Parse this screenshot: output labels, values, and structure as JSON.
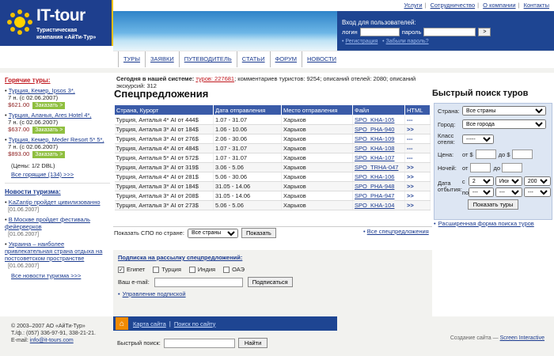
{
  "logo": {
    "brand": "IT-tour",
    "subtitle_line1": "Туристическая",
    "subtitle_line2": "компания «АйТи-Тур»"
  },
  "top_menu": [
    "Услуги",
    "Сотрудничество",
    "О компании",
    "Контакты"
  ],
  "login": {
    "title": "Вход для пользователей:",
    "login_label": "логин",
    "password_label": "пароль",
    "submit": ">",
    "register": "Регистрация",
    "forgot": "Забыли пароль?"
  },
  "nav": [
    "ТУРЫ",
    "ЗАЯВКИ",
    "ПУТЕВОДИТЕЛЬ",
    "СТАТЬИ",
    "ФОРУМ",
    "НОВОСТИ"
  ],
  "notice": {
    "prefix": "Сегодня в нашей системе:",
    "tours": "туров: 227681",
    "rest": "; комментариев туристов: 9254; описаний отелей: 2080; описаний экскурсий: 312"
  },
  "hot_tours": {
    "title": "Горячие туры:",
    "items": [
      {
        "name": "Турция, Кемер, Ipsos 3*,",
        "nights": "7 н. (с 02.06.2007)",
        "price": "$621.00",
        "order": "Заказать >"
      },
      {
        "name": "Турция, Аланья, Ares Hotel 4*,",
        "nights": "7 н. (с 02.06.2007)",
        "price": "$637.00",
        "order": "Заказать >"
      },
      {
        "name": "Турция, Кемер, Meder Resort 5* 5*,",
        "nights": "7 н. (с 02.06.2007)",
        "price": "$893.00",
        "order": "Заказать >"
      }
    ],
    "price_note": "(Цены: 1/2 DBL)",
    "all_link": "Все горящие (134) >>>"
  },
  "news": {
    "title": "Новости туризма:",
    "items": [
      {
        "text": "KaZantip пройдет цивилизованно",
        "date": "[01.06.2007]"
      },
      {
        "text": "В Москве пройдет фестиваль фейерверков",
        "date": "[01.06.2007]"
      },
      {
        "text": "Украина – наиболее привлекательная страна отдыха на постсоветском пространстве",
        "date": "[01.06.2007]"
      }
    ],
    "all_link": "Все новости туризма >>>"
  },
  "offers": {
    "title": "Спецпредложения",
    "columns": [
      "Страна, Курорт",
      "Дата отправления",
      "Место отправления",
      "Файл",
      "HTML"
    ],
    "rows": [
      [
        "Турция, Анталья 4* AI от 444$",
        "1.07 - 31.07",
        "Харьков",
        "SPO_KHA-105",
        "---"
      ],
      [
        "Турция, Анталья 3* AI от 184$",
        "1.06 - 10.06",
        "Харьков",
        "SPO_PHA-940",
        ">>"
      ],
      [
        "Турция, Анталья 3* AI от 276$",
        "2.06 - 30.06",
        "Харьков",
        "SPO_KHA-109",
        "---"
      ],
      [
        "Турция, Анталья 4* AI от 484$",
        "1.07 - 31.07",
        "Харьков",
        "SPO_KHA-108",
        "---"
      ],
      [
        "Турция, Анталья 5* AI от 572$",
        "1.07 - 31.07",
        "Харьков",
        "SPO_KHA-107",
        "---"
      ],
      [
        "Турция, Анталья 3* AI от 319$",
        "3.06 - 5.06",
        "Харьков",
        "SPO_TRHA-047",
        ">>"
      ],
      [
        "Турция, Анталья 4* AI от 281$",
        "5.06 - 30.06",
        "Харьков",
        "SPO_KHA-106",
        ">>"
      ],
      [
        "Турция, Анталья 3* AI от 184$",
        "31.05 - 14.06",
        "Харьков",
        "SPO_PHA-948",
        ">>"
      ],
      [
        "Турция, Анталья 3* AI от 208$",
        "31.05 - 14.06",
        "Харьков",
        "SPO_PHA-947",
        ">>"
      ],
      [
        "Турция, Анталья 3* AI от 273$",
        "5.06 - 5.06",
        "Харьков",
        "SPO_KHA-104",
        ">>"
      ]
    ],
    "filter_label": "Показать СПО по стране:",
    "filter_value": "Все страны",
    "filter_button": "Показать",
    "all_link": "Все спецпредложения"
  },
  "subscribe": {
    "title": "Подписка на рассылку спецпредложений:",
    "countries": [
      {
        "name": "Египет",
        "checked": true
      },
      {
        "name": "Турция",
        "checked": false
      },
      {
        "name": "Индия",
        "checked": false
      },
      {
        "name": "ОАЭ",
        "checked": false
      }
    ],
    "email_label": "Ваш e-mail:",
    "button": "Подписаться",
    "manage": "Управление подпиской"
  },
  "quick_search": {
    "title": "Быстрый поиск туров",
    "country_label": "Страна:",
    "country_value": "Все страны",
    "city_label": "Город:",
    "city_value": "Все города",
    "class_label": "Класс отеля:",
    "class_value": "-----",
    "price_label": "Цена:",
    "price_from": "от $",
    "price_to": "до $",
    "nights_label": "Ночей:",
    "nights_from": "от",
    "nights_to": "до",
    "date_label": "Дата отбытия:",
    "from_prefix": "с",
    "to_prefix": "по",
    "from_day": "2",
    "from_month": "Июн",
    "from_year": "2007",
    "to_day": "---",
    "to_month": "---",
    "to_year": "---",
    "button": "Показать туры",
    "adv_link": "Расширенная форма поиска туров"
  },
  "footer": {
    "copyright": "© 2003–2007 АО «АйТи-Тур»",
    "phones": "Т./ф.: (057) 336-97-91, 338-21-21.",
    "email_label": "E-mail:",
    "email": "info@it-tours.com",
    "sitemap": "Карта сайта",
    "search_site": "Поиск по сайту",
    "quick_search_label": "Быстрый поиск:",
    "find_button": "Найти",
    "credit_prefix": "Создание сайта — ",
    "credit": "Screen Interactive"
  },
  "colors": {
    "brand_blue": "#1e4592",
    "hot_red": "#c0171d",
    "order_green": "#8fbf3f",
    "table_header": "#3a5ba8"
  }
}
